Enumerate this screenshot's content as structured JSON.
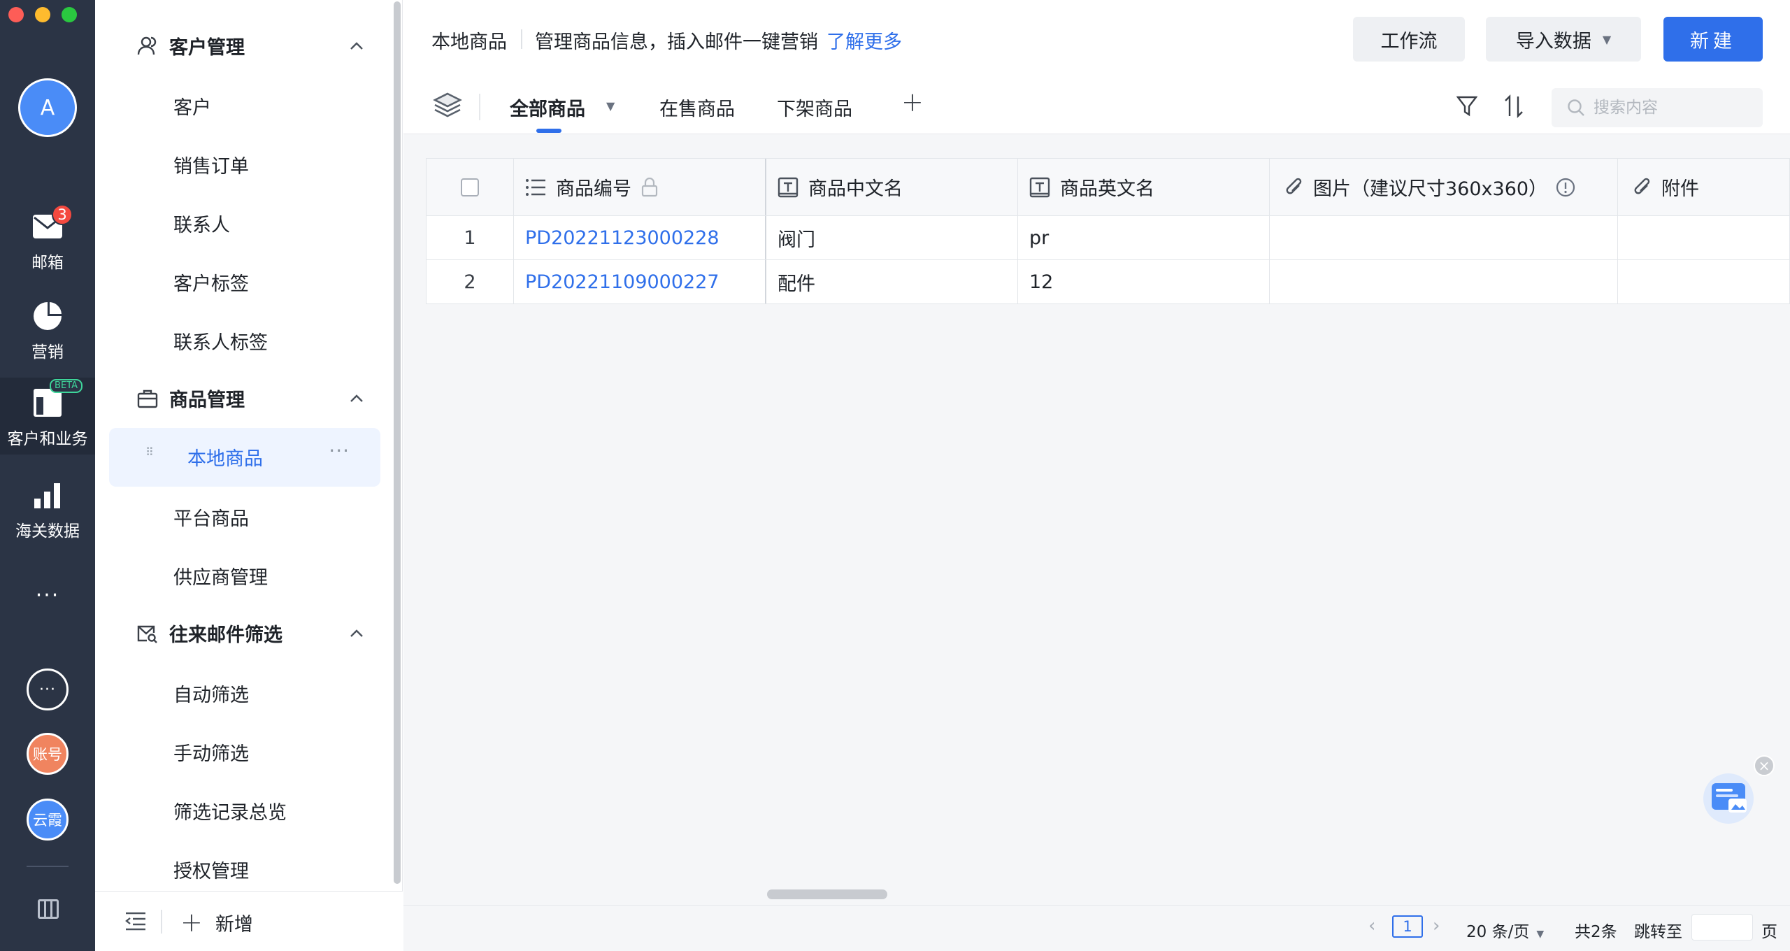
{
  "rail": {
    "avatar_letter": "A",
    "items": [
      {
        "label": "邮箱",
        "badge": "3"
      },
      {
        "label": "营销"
      },
      {
        "label": "客户和业务",
        "badge": "BETA"
      },
      {
        "label": "海关数据"
      }
    ],
    "more": "···",
    "circle_more": "···",
    "account": "账号",
    "user": "云霞"
  },
  "sidebar": {
    "groups": [
      {
        "label": "客户管理",
        "items": [
          "客户",
          "销售订单",
          "联系人",
          "客户标签",
          "联系人标签"
        ]
      },
      {
        "label": "商品管理",
        "items": [
          "本地商品",
          "平台商品",
          "供应商管理"
        ]
      },
      {
        "label": "往来邮件筛选",
        "items": [
          "自动筛选",
          "手动筛选",
          "筛选记录总览",
          "授权管理"
        ]
      }
    ],
    "active_item": "本地商品",
    "add_label": "新增"
  },
  "header": {
    "title": "本地商品",
    "description": "管理商品信息，插入邮件一键营销",
    "learn_more": "了解更多",
    "workflow": "工作流",
    "import": "导入数据",
    "new": "新建"
  },
  "tabs": {
    "all": "全部商品",
    "on_sale": "在售商品",
    "off_shelf": "下架商品"
  },
  "search": {
    "placeholder": "搜索内容"
  },
  "table": {
    "columns": [
      "商品编号",
      "商品中文名",
      "商品英文名",
      "图片（建议尺寸360x360）",
      "附件"
    ],
    "rows": [
      {
        "num": "1",
        "code": "PD20221123000228",
        "cn": "阀门",
        "en": "pr",
        "image": "",
        "attachment": ""
      },
      {
        "num": "2",
        "code": "PD20221109000227",
        "cn": "配件",
        "en": "12",
        "image": "",
        "attachment": ""
      }
    ]
  },
  "pager": {
    "current": "1",
    "page_size": "20 条/页",
    "total": "共2条",
    "jump_label": "跳转至",
    "page_unit": "页"
  },
  "colors": {
    "accent": "#2f6fea",
    "rail_bg": "#2b3445",
    "badge_red": "#f4493f",
    "beta_green": "#3ed59a"
  }
}
